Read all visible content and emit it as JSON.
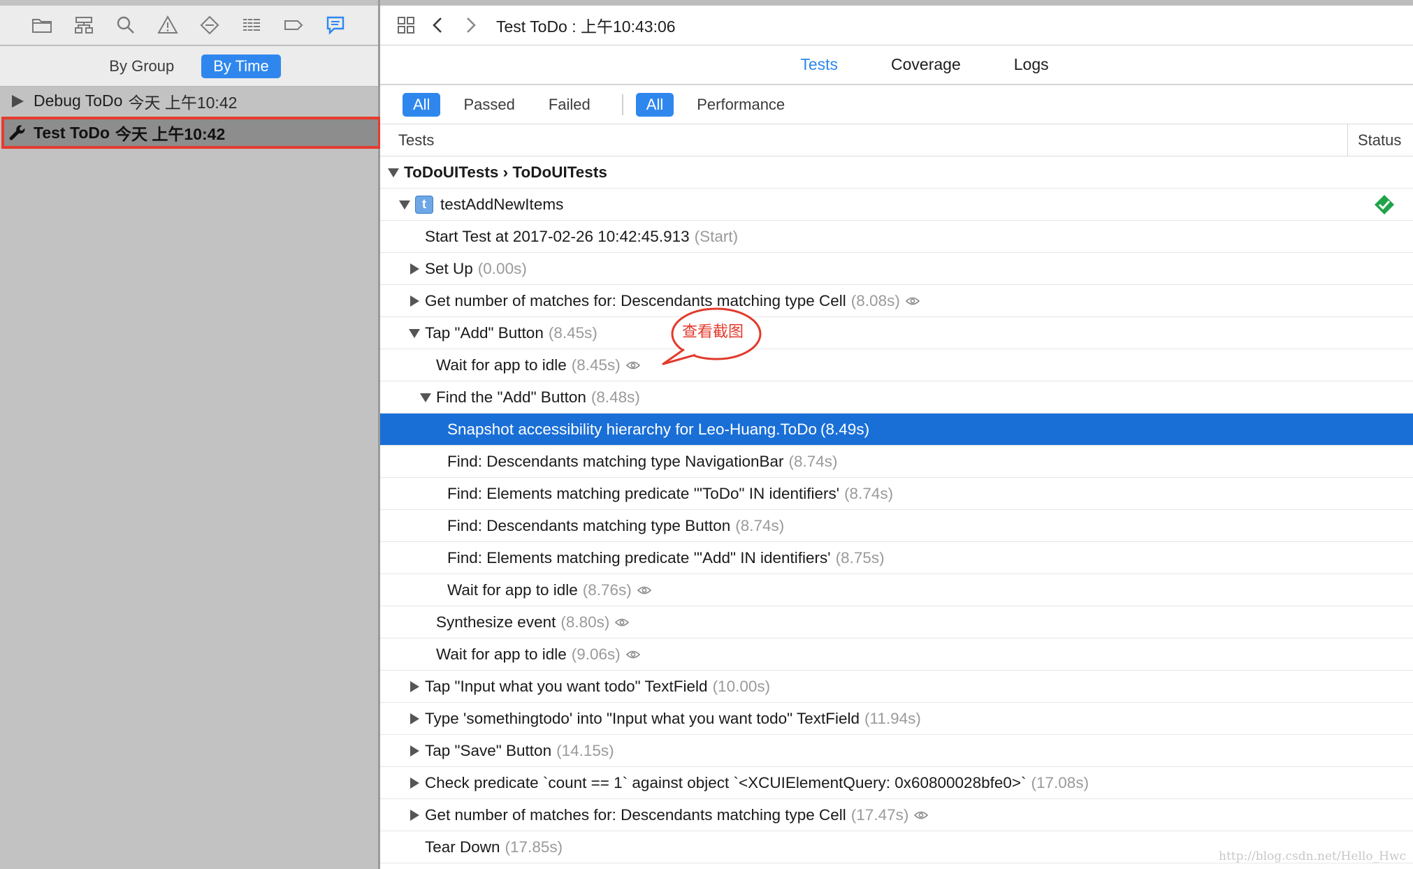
{
  "navigator": {
    "icons": [
      "folder-icon",
      "hierarchy-icon",
      "search-icon",
      "warning-icon",
      "diamond-test-icon",
      "list-debug-icon",
      "tag-breakpoint-icon",
      "report-bubble-icon"
    ],
    "filter": {
      "by_group": "By Group",
      "by_time": "By Time",
      "selected": "By Time"
    },
    "items": [
      {
        "name": "Debug ToDo",
        "date": "今天 上午10:42",
        "icon": "play-triangle-icon"
      },
      {
        "name": "Test ToDo",
        "date": "今天 上午10:42",
        "icon": "wrench-icon",
        "selected": true
      }
    ]
  },
  "jump_bar": {
    "title": "Test ToDo : 上午10:43:06"
  },
  "tabs": [
    {
      "label": "Tests",
      "active": true
    },
    {
      "label": "Coverage",
      "active": false
    },
    {
      "label": "Logs",
      "active": false
    }
  ],
  "scope": {
    "all1": "All",
    "passed": "Passed",
    "failed": "Failed",
    "all2": "All",
    "performance": "Performance"
  },
  "columns": {
    "tests": "Tests",
    "status": "Status"
  },
  "rows": [
    {
      "text": "ToDoUITests  ›  ToDoUITests",
      "dur": "",
      "tri": "down",
      "group": true
    },
    {
      "text": "testAddNewItems",
      "dur": "",
      "tri": "down",
      "badge": "t",
      "status": "passed"
    },
    {
      "text": "Start Test at 2017-02-26 10:42:45.913",
      "dur": "(Start)"
    },
    {
      "text": "Set Up",
      "dur": "(0.00s)",
      "tri": "right"
    },
    {
      "text": "Get number of matches for: Descendants matching type Cell",
      "dur": "(8.08s)",
      "tri": "right",
      "eye": true
    },
    {
      "text": "Tap \"Add\" Button",
      "dur": "(8.45s)",
      "tri": "down"
    },
    {
      "text": "Wait for app to idle",
      "dur": "(8.45s)",
      "eye": true
    },
    {
      "text": "Find the \"Add\" Button",
      "dur": "(8.48s)",
      "tri": "down"
    },
    {
      "text": "Snapshot accessibility hierarchy for Leo-Huang.ToDo",
      "dur": "(8.49s)",
      "selected": true
    },
    {
      "text": "Find: Descendants matching type NavigationBar",
      "dur": "(8.74s)"
    },
    {
      "text": "Find: Elements matching predicate '\"ToDo\" IN identifiers'",
      "dur": "(8.74s)"
    },
    {
      "text": "Find: Descendants matching type Button",
      "dur": "(8.74s)"
    },
    {
      "text": "Find: Elements matching predicate '\"Add\" IN identifiers'",
      "dur": "(8.75s)"
    },
    {
      "text": "Wait for app to idle",
      "dur": "(8.76s)",
      "eye": true
    },
    {
      "text": "Synthesize event",
      "dur": "(8.80s)",
      "eye": true
    },
    {
      "text": "Wait for app to idle",
      "dur": "(9.06s)",
      "eye": true
    },
    {
      "text": "Tap \"Input what you want todo\" TextField",
      "dur": "(10.00s)",
      "tri": "right"
    },
    {
      "text": "Type 'somethingtodo' into \"Input what you want todo\" TextField",
      "dur": "(11.94s)",
      "tri": "right"
    },
    {
      "text": "Tap \"Save\" Button",
      "dur": "(14.15s)",
      "tri": "right"
    },
    {
      "text": "Check predicate `count == 1` against object `<XCUIElementQuery: 0x60800028bfe0>`",
      "dur": "(17.08s)",
      "tri": "right"
    },
    {
      "text": "Get number of matches for: Descendants matching type Cell",
      "dur": "(17.47s)",
      "tri": "right",
      "eye": true
    },
    {
      "text": "Tear Down",
      "dur": "(17.85s)"
    }
  ],
  "annotation": {
    "callout_text": "查看截图",
    "color": "#e23a2c"
  },
  "watermark": "http://blog.csdn.net/Hello_Hwc",
  "colors": {
    "accent": "#2f87ee",
    "selection": "#1a6fd7",
    "success": "#1fa34a",
    "highlight_border": "#e43c2f"
  }
}
